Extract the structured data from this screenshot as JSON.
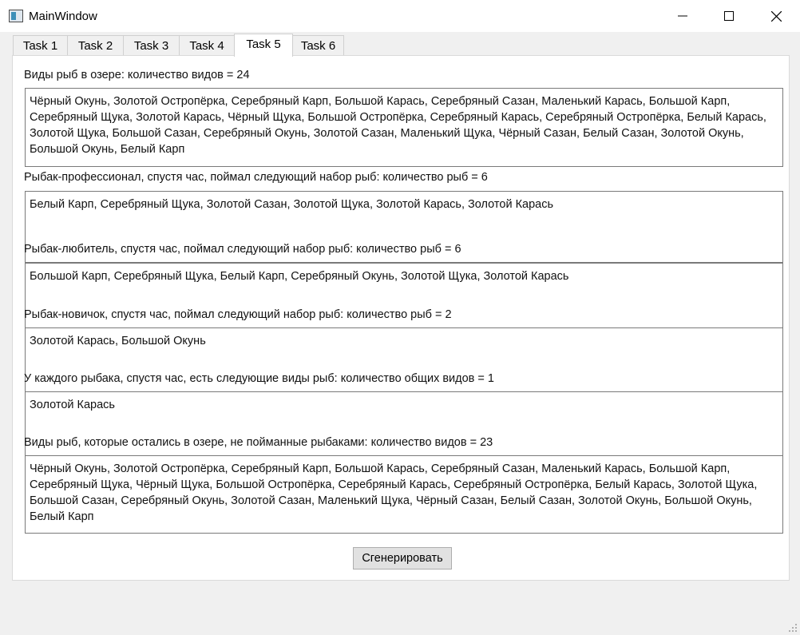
{
  "window": {
    "title": "MainWindow"
  },
  "tabs": [
    {
      "label": "Task 1"
    },
    {
      "label": "Task 2"
    },
    {
      "label": "Task 3"
    },
    {
      "label": "Task 4"
    },
    {
      "label": "Task 5"
    },
    {
      "label": "Task 6"
    }
  ],
  "active_tab": "Task 5",
  "sections": {
    "lake": {
      "label": "Виды рыб в озере: количество видов = 24",
      "text": "Чёрный Окунь, Золотой Остропёрка, Серебряный Карп, Большой Карась, Серебряный Сазан, Маленький Карась, Большой Карп, Серебряный Щука, Золотой Карась, Чёрный Щука, Большой Остропёрка, Серебряный Карась, Серебряный Остропёрка, Белый Карась, Золотой Щука, Большой Сазан, Серебряный Окунь, Золотой Сазан, Маленький Щука, Чёрный Сазан, Белый Сазан, Золотой Окунь, Большой Окунь, Белый Карп"
    },
    "professional": {
      "label": "Рыбак-профессионал, спустя час, поймал следующий набор рыб: количество рыб = 6",
      "text": "Белый Карп, Серебряный Щука, Золотой Сазан, Золотой Щука, Золотой Карась, Золотой Карась"
    },
    "amateur": {
      "label": "Рыбак-любитель, спустя час, поймал следующий набор рыб: количество рыб = 6",
      "text": "Большой Карп, Серебряный Щука, Белый Карп, Серебряный Окунь, Золотой Щука, Золотой Карась"
    },
    "novice": {
      "label": "Рыбак-новичок, спустя час, поймал следующий набор рыб: количество рыб = 2",
      "text": "Золотой Карась, Большой Окунь"
    },
    "common": {
      "label": "У каждого рыбака, спустя час, есть следующие виды рыб: количество общих видов = 1",
      "text": "Золотой Карась"
    },
    "remaining": {
      "label": "Виды рыб, которые остались в озере, не пойманные рыбаками: количество видов = 23",
      "text": "Чёрный Окунь, Золотой Остропёрка, Серебряный Карп, Большой Карась, Серебряный Сазан, Маленький Карась, Большой Карп, Серебряный Щука, Чёрный Щука, Большой Остропёрка, Серебряный Карась, Серебряный Остропёрка, Белый Карась, Золотой Щука, Большой Сазан, Серебряный Окунь, Золотой Сазан, Маленький Щука, Чёрный Сазан, Белый Сазан, Золотой Окунь, Большой Окунь, Белый Карп"
    }
  },
  "buttons": {
    "generate": "Сгенерировать"
  },
  "icons": {
    "app": "app-window-icon",
    "minimize": "minimize-icon",
    "maximize": "maximize-icon",
    "close": "close-icon",
    "grip": "resize-grip-icon"
  }
}
